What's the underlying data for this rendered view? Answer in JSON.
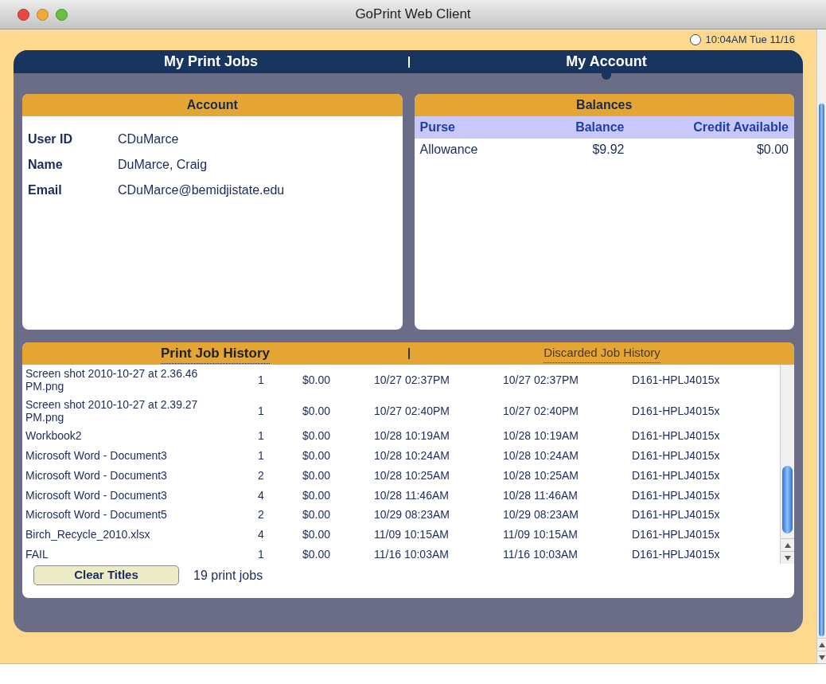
{
  "window": {
    "title": "GoPrint Web Client"
  },
  "clock": "10:04AM Tue 11/16",
  "tabs": [
    {
      "label": "My Print Jobs",
      "selected": false
    },
    {
      "label": "My Account",
      "selected": true
    }
  ],
  "account": {
    "title": "Account",
    "fields": [
      {
        "label": "User ID",
        "value": "CDuMarce"
      },
      {
        "label": "Name",
        "value": "DuMarce, Craig"
      },
      {
        "label": "Email",
        "value": "CDuMarce@bemidjistate.edu"
      }
    ]
  },
  "balances": {
    "title": "Balances",
    "columns": [
      "Purse",
      "Balance",
      "Credit Available"
    ],
    "rows": [
      [
        "Allowance",
        "$9.92",
        "$0.00"
      ]
    ]
  },
  "history_tabs": [
    {
      "label": "Print Job History",
      "selected": true
    },
    {
      "label": "Discarded Job History",
      "selected": false
    }
  ],
  "history_rows": [
    [
      "Screen shot 2010-10-27 at 2.36.46 PM.png",
      "1",
      "$0.00",
      "10/27 02:37PM",
      "10/27 02:37PM",
      "D161-HPLJ4015x"
    ],
    [
      "Screen shot 2010-10-27 at 2.39.27 PM.png",
      "1",
      "$0.00",
      "10/27 02:40PM",
      "10/27 02:40PM",
      "D161-HPLJ4015x"
    ],
    [
      "Workbook2",
      "1",
      "$0.00",
      "10/28 10:19AM",
      "10/28 10:19AM",
      "D161-HPLJ4015x"
    ],
    [
      "Microsoft Word - Document3",
      "1",
      "$0.00",
      "10/28 10:24AM",
      "10/28 10:24AM",
      "D161-HPLJ4015x"
    ],
    [
      "Microsoft Word - Document3",
      "2",
      "$0.00",
      "10/28 10:25AM",
      "10/28 10:25AM",
      "D161-HPLJ4015x"
    ],
    [
      "Microsoft Word - Document3",
      "4",
      "$0.00",
      "10/28 11:46AM",
      "10/28 11:46AM",
      "D161-HPLJ4015x"
    ],
    [
      "Microsoft Word - Document5",
      "2",
      "$0.00",
      "10/29 08:23AM",
      "10/29 08:23AM",
      "D161-HPLJ4015x"
    ],
    [
      "Birch_Recycle_2010.xlsx",
      "4",
      "$0.00",
      "11/09 10:15AM",
      "11/09 10:15AM",
      "D161-HPLJ4015x"
    ],
    [
      "FAIL",
      "1",
      "$0.00",
      "11/16 10:03AM",
      "11/16 10:03AM",
      "D161-HPLJ4015x"
    ]
  ],
  "clear_button": "Clear Titles",
  "job_count": "19 print jobs"
}
